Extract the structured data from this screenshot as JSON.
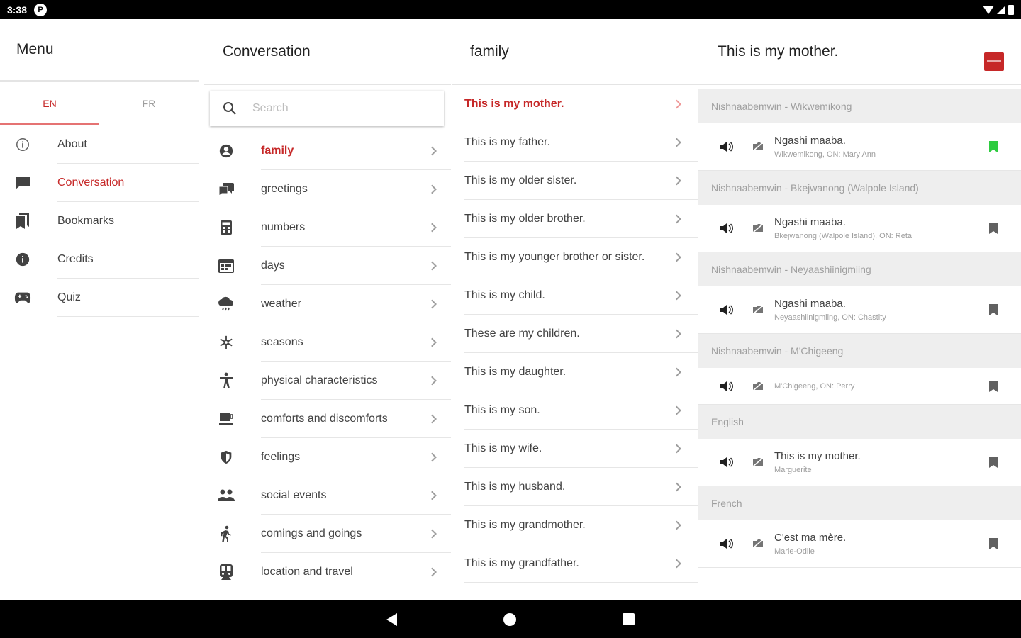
{
  "status": {
    "time": "3:38",
    "app_icon_letter": "P"
  },
  "menu": {
    "title": "Menu",
    "tabs": [
      {
        "label": "EN",
        "active": true
      },
      {
        "label": "FR",
        "active": false
      }
    ],
    "items": [
      {
        "label": "About",
        "icon": "info-outline-icon"
      },
      {
        "label": "Conversation",
        "icon": "chat-icon",
        "active": true
      },
      {
        "label": "Bookmarks",
        "icon": "bookmarks-icon"
      },
      {
        "label": "Credits",
        "icon": "info-icon"
      },
      {
        "label": "Quiz",
        "icon": "gamepad-icon"
      }
    ]
  },
  "conversation": {
    "title": "Conversation",
    "search_placeholder": "Search",
    "categories": [
      {
        "label": "family",
        "icon": "person-icon",
        "active": true
      },
      {
        "label": "greetings",
        "icon": "chat-bubbles-icon"
      },
      {
        "label": "numbers",
        "icon": "calculator-icon"
      },
      {
        "label": "days",
        "icon": "calendar-icon"
      },
      {
        "label": "weather",
        "icon": "cloud-rain-icon"
      },
      {
        "label": "seasons",
        "icon": "snowflake-icon"
      },
      {
        "label": "physical characteristics",
        "icon": "accessibility-icon"
      },
      {
        "label": "comforts and discomforts",
        "icon": "cup-icon"
      },
      {
        "label": "feelings",
        "icon": "heart-shield-icon"
      },
      {
        "label": "social events",
        "icon": "people-icon"
      },
      {
        "label": "comings and goings",
        "icon": "walking-icon"
      },
      {
        "label": "location and travel",
        "icon": "train-icon"
      }
    ]
  },
  "family": {
    "title": "family",
    "phrases": [
      {
        "label": "This is my mother.",
        "active": true
      },
      {
        "label": "This is my father."
      },
      {
        "label": "This is my older sister."
      },
      {
        "label": "This is my older brother."
      },
      {
        "label": "This is my younger brother or sister."
      },
      {
        "label": "This is my child."
      },
      {
        "label": "These are my children."
      },
      {
        "label": "This is my daughter."
      },
      {
        "label": "This is my son."
      },
      {
        "label": "This is my wife."
      },
      {
        "label": "This is my husband."
      },
      {
        "label": "This is my grandmother."
      },
      {
        "label": "This is my grandfather."
      }
    ]
  },
  "detail": {
    "title": "This is my mother.",
    "accent": "#c62828",
    "groups": [
      {
        "header": "Nishnaabemwin - Wikwemikong",
        "main": "Ngashi maaba.",
        "sub": "Wikwemikong, ON: Mary Ann",
        "bookmarked": true
      },
      {
        "header": "Nishnaabemwin - Bkejwanong (Walpole Island)",
        "main": "Ngashi maaba.",
        "sub": "Bkejwanong (Walpole Island), ON: Reta",
        "bookmarked": false
      },
      {
        "header": "Nishnaabemwin - Neyaashiinigmiing",
        "main": "Ngashi maaba.",
        "sub": "Neyaashiinigmiing, ON: Chastity",
        "bookmarked": false
      },
      {
        "header": "Nishnaabemwin - M'Chigeeng",
        "main": "",
        "sub": "M'Chigeeng, ON: Perry",
        "bookmarked": false
      },
      {
        "header": "English",
        "main": "This is my mother.",
        "sub": "Marguerite",
        "bookmarked": false
      },
      {
        "header": "French",
        "main": "C'est ma mère.",
        "sub": "Marie-Odile",
        "bookmarked": false
      }
    ]
  }
}
